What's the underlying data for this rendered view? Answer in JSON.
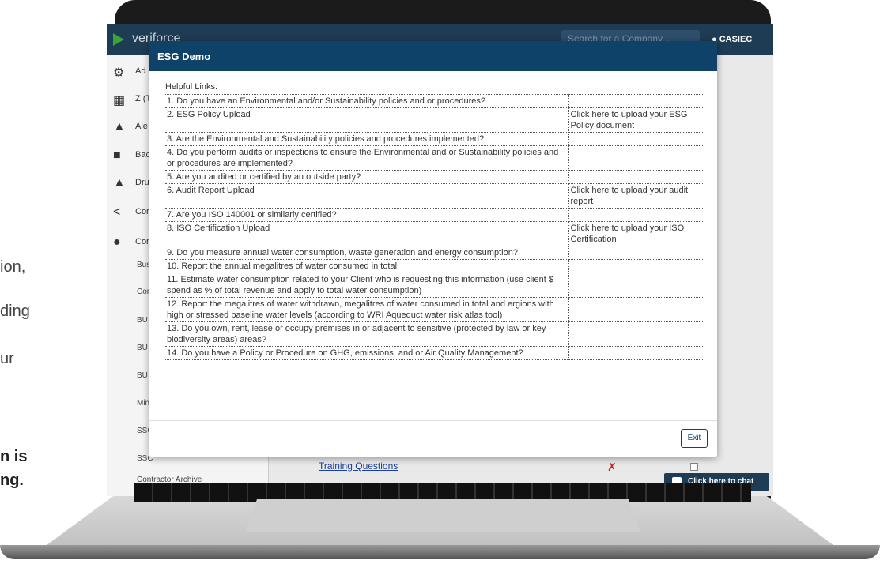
{
  "side_text": {
    "line1": "ion,",
    "line2": "ding",
    "line3": "ur",
    "line4": "n is",
    "line5": "ng."
  },
  "app": {
    "logo": "veriforce",
    "search_placeholder": "Search for a Company...",
    "user": "CASIEC",
    "nav": [
      {
        "icon": "gear-icon",
        "label": "Ad"
      },
      {
        "icon": "building-icon",
        "label": "Z (T"
      },
      {
        "icon": "bell-icon",
        "label": "Ale"
      },
      {
        "icon": "door-icon",
        "label": "Bac"
      },
      {
        "icon": "person-icon",
        "label": "Dru"
      },
      {
        "icon": "share-icon",
        "label": "Cor"
      },
      {
        "icon": "users-icon",
        "label": "Cor"
      }
    ],
    "subnav": [
      "Bus",
      "Cor",
      "BU",
      "BU",
      "BU",
      "Min",
      "SSC",
      "SSC"
    ],
    "archive": "Contractor Archive",
    "training_link": "Training Questions",
    "red_x": "✗",
    "chat": "Click here to chat"
  },
  "modal": {
    "title": "ESG Demo",
    "helpful_links": "Helpful Links:",
    "questions": [
      {
        "q": "1. Do you have an Environmental and/or Sustainability policies and or procedures?",
        "a": ""
      },
      {
        "q": "2. ESG Policy Upload",
        "a": "Click here to upload your ESG Policy document"
      },
      {
        "q": "3. Are the Environmental and Sustainability policies and procedures implemented?",
        "a": ""
      },
      {
        "q": "4. Do you perform audits or inspections to ensure the Environmental and or Sustainability policies and or procedures are implemented?",
        "a": ""
      },
      {
        "q": "5. Are you audited or certified by an outside party?",
        "a": ""
      },
      {
        "q": "6. Audit Report Upload",
        "a": "Click here to upload your audit report"
      },
      {
        "q": "7. Are you ISO 140001 or similarly certified?",
        "a": ""
      },
      {
        "q": "8. ISO Certification Upload",
        "a": "Click here to upload your ISO Certification"
      },
      {
        "q": "9. Do you measure annual water consumption, waste generation and energy consumption?",
        "a": ""
      },
      {
        "q": "10. Report the annual megalitres of water consumed in total.",
        "a": ""
      },
      {
        "q": "11. Estimate water consumption related to your Client who is requesting this information (use client $ spend as % of total revenue and apply to total water consumption)",
        "a": ""
      },
      {
        "q": "12. Report the megalitres of water withdrawn, megalitres of water consumed in total and ergions with high or stressed baseline water levels (according to WRI Aqueduct water risk atlas tool)",
        "a": ""
      },
      {
        "q": "13. Do you own, rent, lease or occupy premises in or adjacent to sensitive (protected by law or key biodiversity areas) areas?",
        "a": ""
      },
      {
        "q": "14. Do you have a Policy or Procedure on GHG, emissions, and or Air Quality Management?",
        "a": ""
      }
    ],
    "exit_label": "Exit"
  },
  "colors": {
    "modal_header": "#0f4268",
    "appbar": "#1f3c55",
    "logo_green": "#3aa43a"
  }
}
